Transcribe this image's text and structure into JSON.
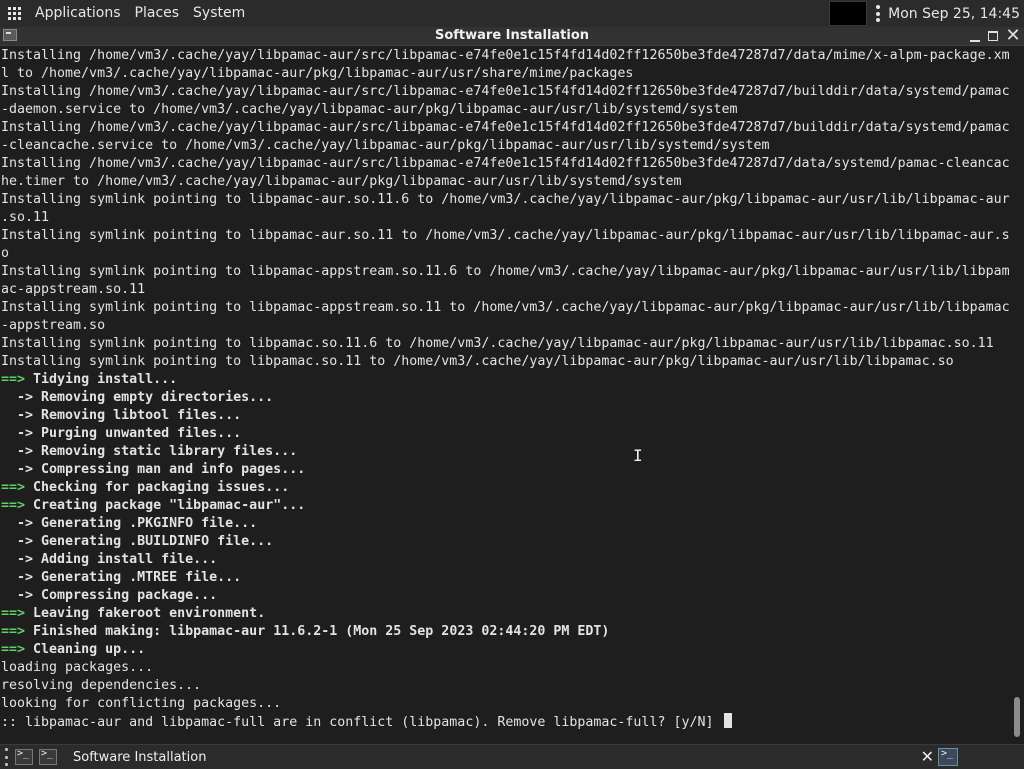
{
  "top_panel": {
    "menus": [
      "Applications",
      "Places",
      "System"
    ],
    "clock": "Mon Sep 25, 14:45"
  },
  "window": {
    "title": "Software Installation"
  },
  "terminal": {
    "lines": [
      {
        "prefix": "",
        "text": "Installing /home/vm3/.cache/yay/libpamac-aur/src/libpamac-e74fe0e1c15f4fd14d02ff12650be3fde47287d7/data/mime/x-alpm-package.xm",
        "bold": false
      },
      {
        "prefix": "",
        "text": "l to /home/vm3/.cache/yay/libpamac-aur/pkg/libpamac-aur/usr/share/mime/packages",
        "bold": false
      },
      {
        "prefix": "",
        "text": "Installing /home/vm3/.cache/yay/libpamac-aur/src/libpamac-e74fe0e1c15f4fd14d02ff12650be3fde47287d7/builddir/data/systemd/pamac",
        "bold": false
      },
      {
        "prefix": "",
        "text": "-daemon.service to /home/vm3/.cache/yay/libpamac-aur/pkg/libpamac-aur/usr/lib/systemd/system",
        "bold": false
      },
      {
        "prefix": "",
        "text": "Installing /home/vm3/.cache/yay/libpamac-aur/src/libpamac-e74fe0e1c15f4fd14d02ff12650be3fde47287d7/builddir/data/systemd/pamac",
        "bold": false
      },
      {
        "prefix": "",
        "text": "-cleancache.service to /home/vm3/.cache/yay/libpamac-aur/pkg/libpamac-aur/usr/lib/systemd/system",
        "bold": false
      },
      {
        "prefix": "",
        "text": "Installing /home/vm3/.cache/yay/libpamac-aur/src/libpamac-e74fe0e1c15f4fd14d02ff12650be3fde47287d7/data/systemd/pamac-cleancac",
        "bold": false
      },
      {
        "prefix": "",
        "text": "he.timer to /home/vm3/.cache/yay/libpamac-aur/pkg/libpamac-aur/usr/lib/systemd/system",
        "bold": false
      },
      {
        "prefix": "",
        "text": "Installing symlink pointing to libpamac-aur.so.11.6 to /home/vm3/.cache/yay/libpamac-aur/pkg/libpamac-aur/usr/lib/libpamac-aur",
        "bold": false
      },
      {
        "prefix": "",
        "text": ".so.11",
        "bold": false
      },
      {
        "prefix": "",
        "text": "Installing symlink pointing to libpamac-aur.so.11 to /home/vm3/.cache/yay/libpamac-aur/pkg/libpamac-aur/usr/lib/libpamac-aur.s",
        "bold": false
      },
      {
        "prefix": "",
        "text": "o",
        "bold": false
      },
      {
        "prefix": "",
        "text": "Installing symlink pointing to libpamac-appstream.so.11.6 to /home/vm3/.cache/yay/libpamac-aur/pkg/libpamac-aur/usr/lib/libpam",
        "bold": false
      },
      {
        "prefix": "",
        "text": "ac-appstream.so.11",
        "bold": false
      },
      {
        "prefix": "",
        "text": "Installing symlink pointing to libpamac-appstream.so.11 to /home/vm3/.cache/yay/libpamac-aur/pkg/libpamac-aur/usr/lib/libpamac",
        "bold": false
      },
      {
        "prefix": "",
        "text": "-appstream.so",
        "bold": false
      },
      {
        "prefix": "",
        "text": "Installing symlink pointing to libpamac.so.11.6 to /home/vm3/.cache/yay/libpamac-aur/pkg/libpamac-aur/usr/lib/libpamac.so.11",
        "bold": false
      },
      {
        "prefix": "",
        "text": "Installing symlink pointing to libpamac.so.11 to /home/vm3/.cache/yay/libpamac-aur/pkg/libpamac-aur/usr/lib/libpamac.so",
        "bold": false
      },
      {
        "prefix": "==>",
        "text": " Tidying install...",
        "bold": true
      },
      {
        "prefix": "",
        "text": "  -> Removing empty directories...",
        "bold": true
      },
      {
        "prefix": "",
        "text": "  -> Removing libtool files...",
        "bold": true
      },
      {
        "prefix": "",
        "text": "  -> Purging unwanted files...",
        "bold": true
      },
      {
        "prefix": "",
        "text": "  -> Removing static library files...",
        "bold": true
      },
      {
        "prefix": "",
        "text": "  -> Compressing man and info pages...",
        "bold": true
      },
      {
        "prefix": "==>",
        "text": " Checking for packaging issues...",
        "bold": true
      },
      {
        "prefix": "==>",
        "text": " Creating package \"libpamac-aur\"...",
        "bold": true
      },
      {
        "prefix": "",
        "text": "  -> Generating .PKGINFO file...",
        "bold": true
      },
      {
        "prefix": "",
        "text": "  -> Generating .BUILDINFO file...",
        "bold": true
      },
      {
        "prefix": "",
        "text": "  -> Adding install file...",
        "bold": true
      },
      {
        "prefix": "",
        "text": "  -> Generating .MTREE file...",
        "bold": true
      },
      {
        "prefix": "",
        "text": "  -> Compressing package...",
        "bold": true
      },
      {
        "prefix": "==>",
        "text": " Leaving fakeroot environment.",
        "bold": true
      },
      {
        "prefix": "==>",
        "text": " Finished making: libpamac-aur 11.6.2-1 (Mon 25 Sep 2023 02:44:20 PM EDT)",
        "bold": true
      },
      {
        "prefix": "==>",
        "text": " Cleaning up...",
        "bold": true
      },
      {
        "prefix": "",
        "text": "loading packages...",
        "bold": false
      },
      {
        "prefix": "",
        "text": "resolving dependencies...",
        "bold": false
      },
      {
        "prefix": "",
        "text": "looking for conflicting packages...",
        "bold": false
      },
      {
        "prefix": "",
        "text": ":: libpamac-aur and libpamac-full are in conflict (libpamac). Remove libpamac-full? [y/N] ",
        "bold": false,
        "cursor": true
      }
    ]
  },
  "taskbar": {
    "task_label": "Software Installation"
  },
  "icons": {
    "apps": "apps-grid-icon",
    "terminal": "terminal-icon",
    "close": "close-icon"
  }
}
